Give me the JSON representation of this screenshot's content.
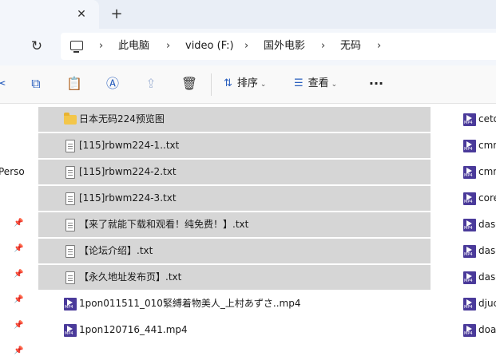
{
  "tab": {
    "close_glyph": "✕",
    "new_tab_glyph": "+"
  },
  "nav": {
    "forward_glyph": "›",
    "refresh_glyph": "↻"
  },
  "breadcrumb": {
    "items": [
      "此电脑",
      "video (F:)",
      "国外电影",
      "无码"
    ],
    "separator": "›"
  },
  "toolbar": {
    "icons": [
      "cut-icon",
      "copy-icon",
      "paste-icon",
      "rename-icon",
      "share-icon",
      "delete-icon"
    ],
    "sort_label": "排序",
    "view_label": "查看",
    "more_glyph": "···"
  },
  "sidebar": {
    "partial_label": "Perso"
  },
  "files": [
    {
      "name": "日本无码224预览图",
      "type": "folder",
      "selected": true
    },
    {
      "name": "[115]rbwm224-1..txt",
      "type": "txt",
      "selected": true
    },
    {
      "name": "[115]rbwm224-2.txt",
      "type": "txt",
      "selected": true
    },
    {
      "name": "[115]rbwm224-3.txt",
      "type": "txt",
      "selected": true
    },
    {
      "name": "【来了就能下载和观看！纯免费！】.txt",
      "type": "txt",
      "selected": true
    },
    {
      "name": "【论坛介绍】.txt",
      "type": "txt",
      "selected": true
    },
    {
      "name": "【永久地址发布页】.txt",
      "type": "txt",
      "selected": true
    },
    {
      "name": "1pon011511_010緊縛着物美人_上村あずさ..mp4",
      "type": "mp4",
      "selected": false
    },
    {
      "name": "1pon120716_441.mp4",
      "type": "mp4",
      "selected": false
    }
  ],
  "right_column": [
    {
      "name": "ceto"
    },
    {
      "name": "cmn"
    },
    {
      "name": "cmn"
    },
    {
      "name": "core"
    },
    {
      "name": "dasd"
    },
    {
      "name": "dasd"
    },
    {
      "name": "dasd"
    },
    {
      "name": "djuc"
    },
    {
      "name": "doa"
    }
  ]
}
